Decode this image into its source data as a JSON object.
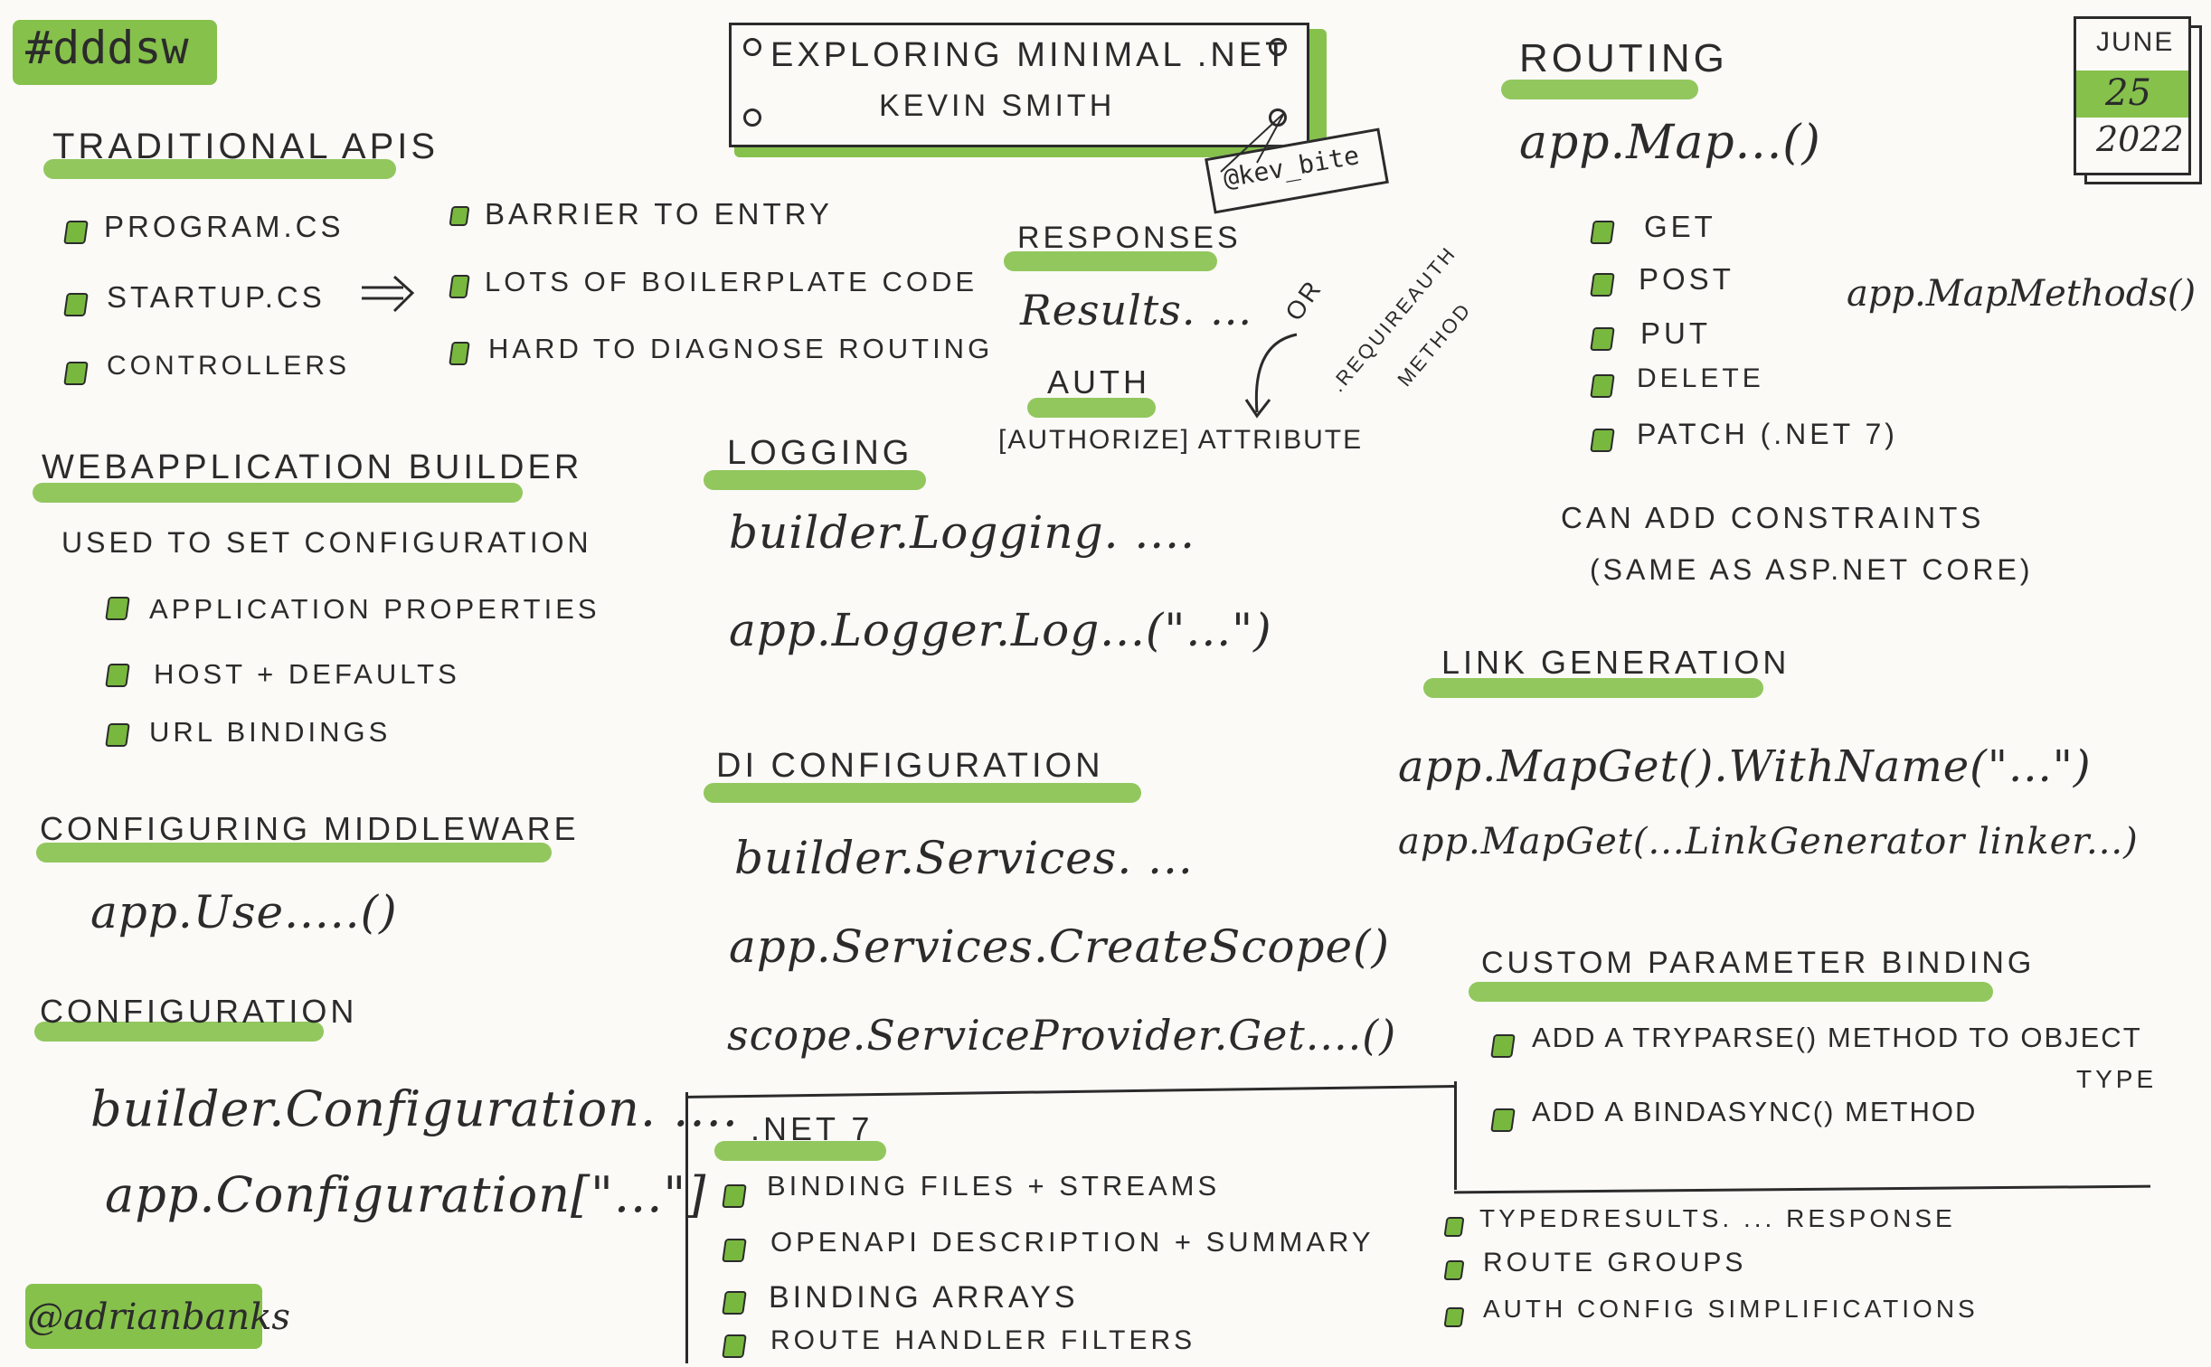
{
  "tags": {
    "top": "#dddsw",
    "bottom": "@adrianbanks"
  },
  "title_box": {
    "line1": "Exploring Minimal .Net",
    "line2": "Kevin Smith",
    "handle": "@kev_bite"
  },
  "calendar": {
    "month": "June",
    "day": "25",
    "year": "2022"
  },
  "traditional": {
    "heading": "Traditional APIs",
    "items": [
      "Program.cs",
      "Startup.cs",
      "Controllers"
    ],
    "problems": [
      "Barrier to entry",
      "Lots of boilerplate code",
      "Hard to diagnose routing"
    ]
  },
  "webapp": {
    "heading": "WebApplication Builder",
    "intro": "Used to set configuration",
    "items": [
      "Application properties",
      "Host + defaults",
      "URL bindings"
    ]
  },
  "middleware": {
    "heading": "Configuring Middleware",
    "code": "app.Use.....()"
  },
  "configuration": {
    "heading": "Configuration",
    "code1": "builder.Configuration. ....",
    "code2": "app.Configuration[\"...\"]"
  },
  "responses": {
    "heading": "Responses",
    "code": "Results. ..."
  },
  "auth": {
    "heading": "Auth",
    "code": "[Authorize] attribute",
    "note1": "or",
    "note2": ".RequireAuth",
    "note3": "Method"
  },
  "logging": {
    "heading": "Logging",
    "code1": "builder.Logging. ....",
    "code2": "app.Logger.Log...(\"...\")"
  },
  "di": {
    "heading": "DI Configuration",
    "code1": "builder.Services. ...",
    "code2": "app.Services.CreateScope()",
    "code3": "scope.ServiceProvider.Get....()"
  },
  "net7": {
    "heading": ".Net 7",
    "items_left": [
      "Binding files + streams",
      "OpenAPI description + summary",
      "Binding arrays",
      "Route handler filters"
    ],
    "items_right": [
      "TypedResults. ... response",
      "Route groups",
      "Auth config simplifications"
    ]
  },
  "routing": {
    "heading": "Routing",
    "code": "app.Map...()",
    "methods": [
      "Get",
      "Post",
      "Put",
      "Delete",
      "Patch (.Net 7)"
    ],
    "side_code": "app.MapMethods()",
    "note1": "Can add constraints",
    "note2": "(same as ASP.Net Core)"
  },
  "link": {
    "heading": "Link Generation",
    "code1": "app.MapGet().WithName(\"...\")",
    "code2": "app.MapGet(...LinkGenerator linker...)"
  },
  "custom": {
    "heading": "Custom Parameter Binding",
    "item1": "Add a TryParse() method to object",
    "item1b": "type",
    "item2": "Add a BindAsync() method"
  },
  "colors": {
    "accent_green": "#86c14c",
    "ink": "#2b2b2b",
    "paper": "#fbfaf7"
  }
}
